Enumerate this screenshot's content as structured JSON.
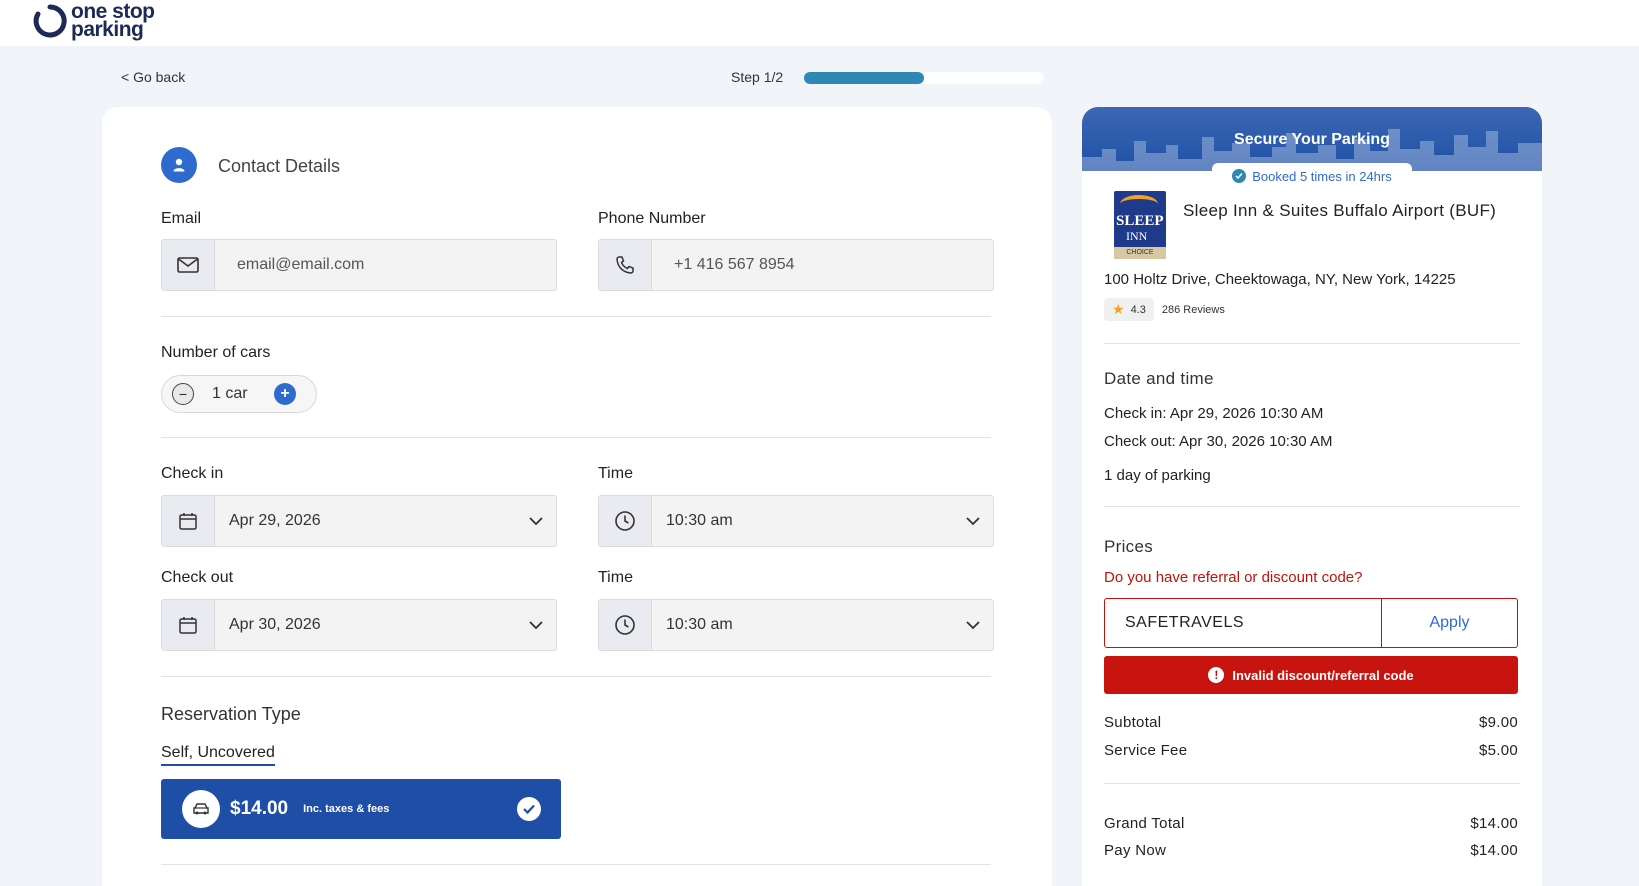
{
  "brand": {
    "line1": "one stop",
    "line2": "parking"
  },
  "nav": {
    "go_back": "< Go back",
    "step": "Step 1/2",
    "progress_fraction": 0.5
  },
  "contact": {
    "title": "Contact Details",
    "email_label": "Email",
    "email_value": "email@email.com",
    "phone_label": "Phone Number",
    "phone_value": "+1 416 567 8954"
  },
  "cars": {
    "label": "Number of cars",
    "minus": "−",
    "plus": "+",
    "value": "1 car"
  },
  "checkin": {
    "label": "Check in",
    "date": "Apr 29, 2026",
    "time_label": "Time",
    "time": "10:30 am"
  },
  "checkout": {
    "label": "Check out",
    "date": "Apr 30, 2026",
    "time_label": "Time",
    "time": "10:30 am"
  },
  "reservation": {
    "title": "Reservation Type",
    "tab": "Self, Uncovered",
    "price": "$14.00",
    "note": "Inc. taxes & fees"
  },
  "summary": {
    "banner_title": "Secure Your Parking",
    "booked": "Booked 5 times in 24hrs",
    "hotel_logo_text1": "SLEEP",
    "hotel_logo_text2": "INN",
    "hotel_logo_strip": "CHOICE",
    "hotel_name": "Sleep Inn & Suites Buffalo Airport (BUF)",
    "address": "100 Holtz Drive, Cheektowaga, NY, New York, 14225",
    "rating": "4.3",
    "reviews": "286 Reviews",
    "date_title": "Date and time",
    "checkin_line": "Check in: Apr 29, 2026 10:30 AM",
    "checkout_line": "Check out: Apr 30, 2026 10:30 AM",
    "duration": "1 day of parking",
    "prices_title": "Prices",
    "discount_question": "Do you have referral or discount code?",
    "code_value": "SAFETRAVELS",
    "apply": "Apply",
    "error": "Invalid discount/referral code",
    "subtotal_label": "Subtotal",
    "subtotal": "$9.00",
    "fee_label": "Service Fee",
    "fee": "$5.00",
    "grand_label": "Grand Total",
    "grand": "$14.00",
    "pay_label": "Pay Now",
    "pay": "$14.00"
  },
  "colors": {
    "primary": "#1f4ea6",
    "accent": "#2f6bcf",
    "progress": "#2f88b3",
    "error": "#c8140e",
    "star": "#f3a023"
  }
}
